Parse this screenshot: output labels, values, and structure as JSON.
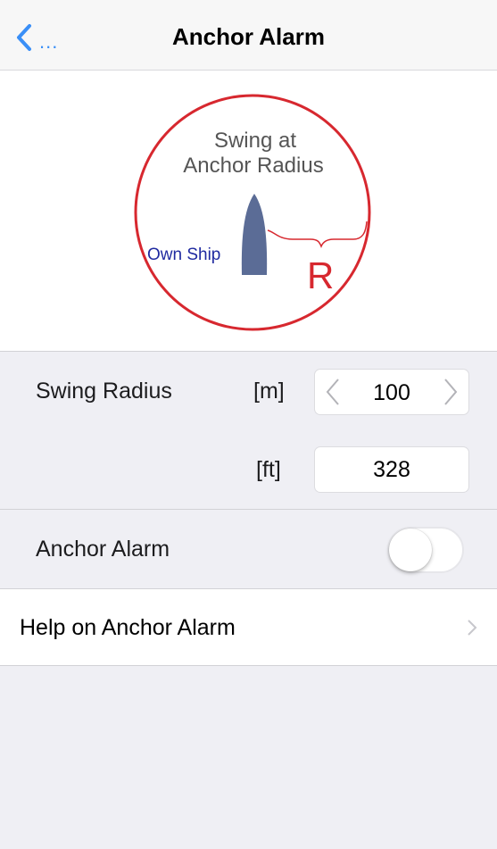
{
  "navbar": {
    "back_label": "...",
    "title": "Anchor Alarm",
    "accent_color": "#3a8ff7"
  },
  "diagram": {
    "title_line1": "Swing at",
    "title_line2": "Anchor Radius",
    "ship_label": "Own Ship",
    "radius_label": "R",
    "circle_color": "#d7282f"
  },
  "swing_radius": {
    "label": "Swing Radius",
    "unit_m": "[m]",
    "value_m": "100",
    "unit_ft": "[ft]",
    "value_ft": "328"
  },
  "anchor_alarm": {
    "label": "Anchor Alarm",
    "enabled": false
  },
  "help": {
    "label": "Help on Anchor Alarm"
  }
}
